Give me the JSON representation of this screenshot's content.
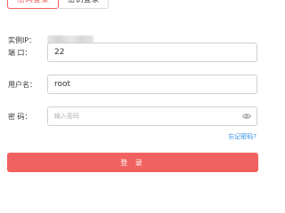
{
  "tabs": [
    {
      "label": "密码登录",
      "active": true
    },
    {
      "label": "密钥登录",
      "active": false
    }
  ],
  "form": {
    "ip_label": "实例IP：",
    "ip_value": "",
    "port_label": "端 口：",
    "port_value": "22",
    "username_label": "用户名：",
    "username_value": "root",
    "password_label": "密 码：",
    "password_placeholder": "输入密码",
    "password_visibility_icon": "eye-icon"
  },
  "forgot_password_label": "忘记密码?",
  "login_button_label": "登 录",
  "colors": {
    "accent": "#f0625f",
    "link": "#2f8ce6",
    "border": "#cfcfcf"
  }
}
